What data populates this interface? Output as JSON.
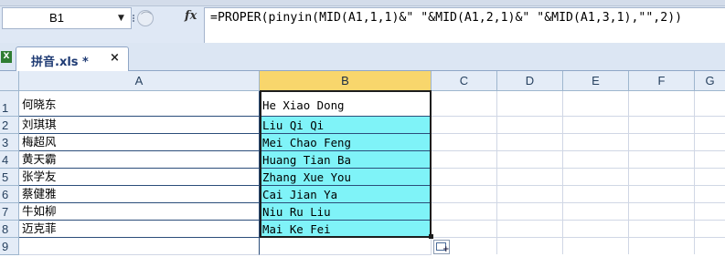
{
  "formula_bar": {
    "name_box": "B1",
    "fx_label": "fx",
    "formula": "=PROPER(pinyin(MID(A1,1,1)&\" \"&MID(A1,2,1)&\" \"&MID(A1,3,1),\"\",2))"
  },
  "tabs": {
    "file_tab": "拼音.xls *",
    "close_symbol": "×"
  },
  "columns": [
    "A",
    "B",
    "C",
    "D",
    "E",
    "F",
    "G"
  ],
  "rows": [
    {
      "num": "1",
      "a": "何晓东",
      "b": "He Xiao Dong"
    },
    {
      "num": "2",
      "a": "刘琪琪",
      "b": "Liu Qi Qi"
    },
    {
      "num": "3",
      "a": "梅超风",
      "b": "Mei Chao Feng"
    },
    {
      "num": "4",
      "a": "黄天霸",
      "b": "Huang Tian Ba"
    },
    {
      "num": "5",
      "a": "张学友",
      "b": "Zhang Xue You"
    },
    {
      "num": "6",
      "a": "蔡健雅",
      "b": "Cai Jian Ya"
    },
    {
      "num": "7",
      "a": "牛如柳",
      "b": "Niu Ru Liu"
    },
    {
      "num": "8",
      "a": "迈克菲",
      "b": "Mai Ke Fei"
    },
    {
      "num": "9",
      "a": "",
      "b": ""
    }
  ],
  "colors": {
    "selection_fill": "#7ff3f8",
    "selected_header": "#f8d66c",
    "header_bg": "#e4ecf7"
  }
}
